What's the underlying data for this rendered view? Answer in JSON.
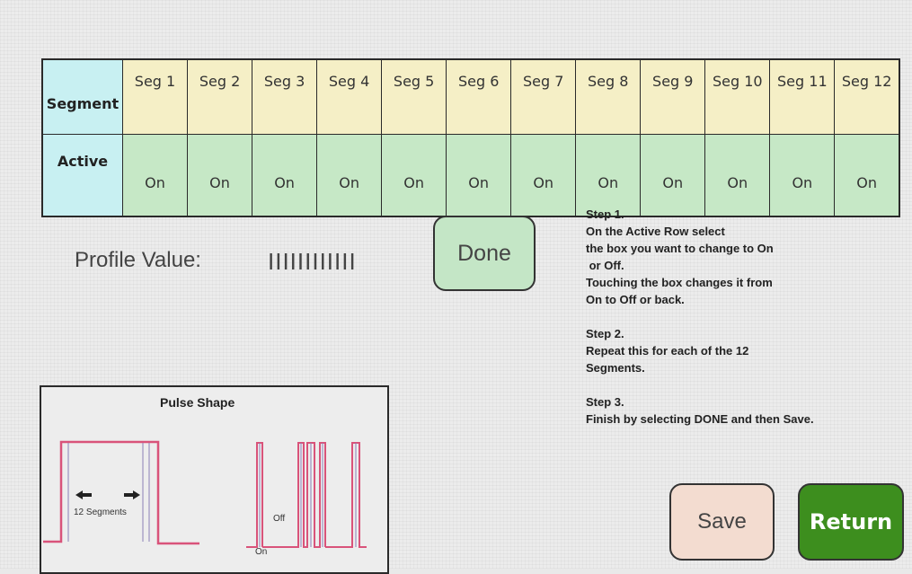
{
  "table": {
    "row1_header": "Segment",
    "row2_header": "Active",
    "segments": [
      "Seg 1",
      "Seg 2",
      "Seg 3",
      "Seg 4",
      "Seg 5",
      "Seg 6",
      "Seg 7",
      "Seg 8",
      "Seg 9",
      "Seg 10",
      "Seg 11",
      "Seg 12"
    ],
    "active": [
      "On",
      "On",
      "On",
      "On",
      "On",
      "On",
      "On",
      "On",
      "On",
      "On",
      "On",
      "On"
    ]
  },
  "profile": {
    "label": "Profile Value:",
    "value": "IIIIIIIIIIII"
  },
  "buttons": {
    "done": "Done",
    "save": "Save",
    "return": "Return"
  },
  "instructions": {
    "step1_title": "Step 1.",
    "step1_lines": [
      "On the Active Row select",
      "the box you want to change to On",
      " or Off.",
      "Touching the box changes it from",
      "On to Off or back."
    ],
    "step2_title": "Step 2.",
    "step2_lines": [
      "Repeat this for each of the 12",
      "Segments."
    ],
    "step3_title": "Step 3.",
    "step3_lines": [
      "Finish by selecting DONE and then Save."
    ]
  },
  "pulse": {
    "title": "Pulse Shape",
    "segments_label": "12 Segments",
    "off_label": "Off",
    "on_label": "On"
  },
  "colors": {
    "segment_header_bg": "#c8f0f2",
    "segment_row_bg": "#f5efc6",
    "active_row_bg": "#c6e8c6",
    "done_bg": "#c4e6c6",
    "save_bg": "#f3dcd0",
    "return_bg": "#3d8e1e",
    "pulse_red": "#d9537a"
  }
}
